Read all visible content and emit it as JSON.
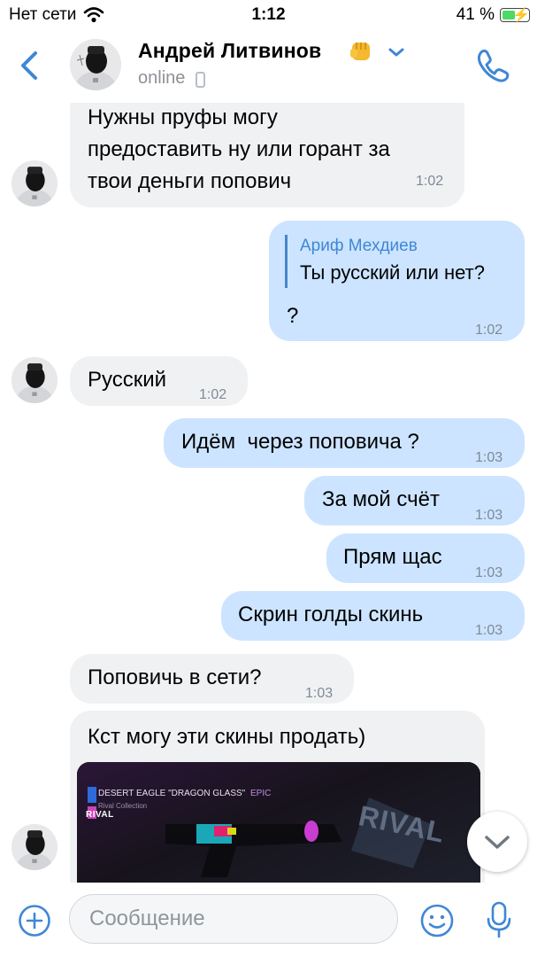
{
  "status_bar": {
    "carrier": "Нет сети",
    "time": "1:12",
    "battery": "41 %"
  },
  "header": {
    "name": "Андрей Литвинов",
    "status": "online",
    "name_emoji_icon": "fist-emoji-icon",
    "colors": {
      "accent": "#3f87d6"
    }
  },
  "messages": [
    {
      "id": "m1",
      "direction": "in",
      "text": "Нужны пруфы могу\nпредоставить ну или горант за\nтвои деньги попович",
      "time": "1:02",
      "avatar": true
    },
    {
      "id": "m2",
      "direction": "out",
      "reply_to": {
        "name": "Ариф Мехдиев",
        "text": "Ты русский или нет?"
      },
      "text": "?",
      "time": "1:02"
    },
    {
      "id": "m3",
      "direction": "in",
      "text": "Русский",
      "time": "1:02",
      "avatar": true
    },
    {
      "id": "m4",
      "direction": "out",
      "text": "Идём  через поповича ?",
      "time": "1:03"
    },
    {
      "id": "m5",
      "direction": "out",
      "text": "За мой счёт",
      "time": "1:03"
    },
    {
      "id": "m6",
      "direction": "out",
      "text": "Прям щас",
      "time": "1:03"
    },
    {
      "id": "m7",
      "direction": "out",
      "text": "Скрин голды скинь",
      "time": "1:03"
    },
    {
      "id": "m8",
      "direction": "in",
      "text": "Поповичь в сети?",
      "time": "1:03"
    },
    {
      "id": "m9",
      "direction": "in",
      "text": "Кст могу эти скины продать)",
      "avatar": true,
      "image": {
        "title": "DESERT EAGLE \"DRAGON GLASS\"",
        "rarity": "EPIC",
        "collection": "Rival Collection",
        "logo": "RIVAL",
        "watermark": "RIVAL"
      }
    }
  ],
  "input": {
    "placeholder": "Сообщение"
  },
  "colors": {
    "incoming": "#f0f1f3",
    "outgoing": "#cce4ff",
    "time": "#7f8a97"
  }
}
